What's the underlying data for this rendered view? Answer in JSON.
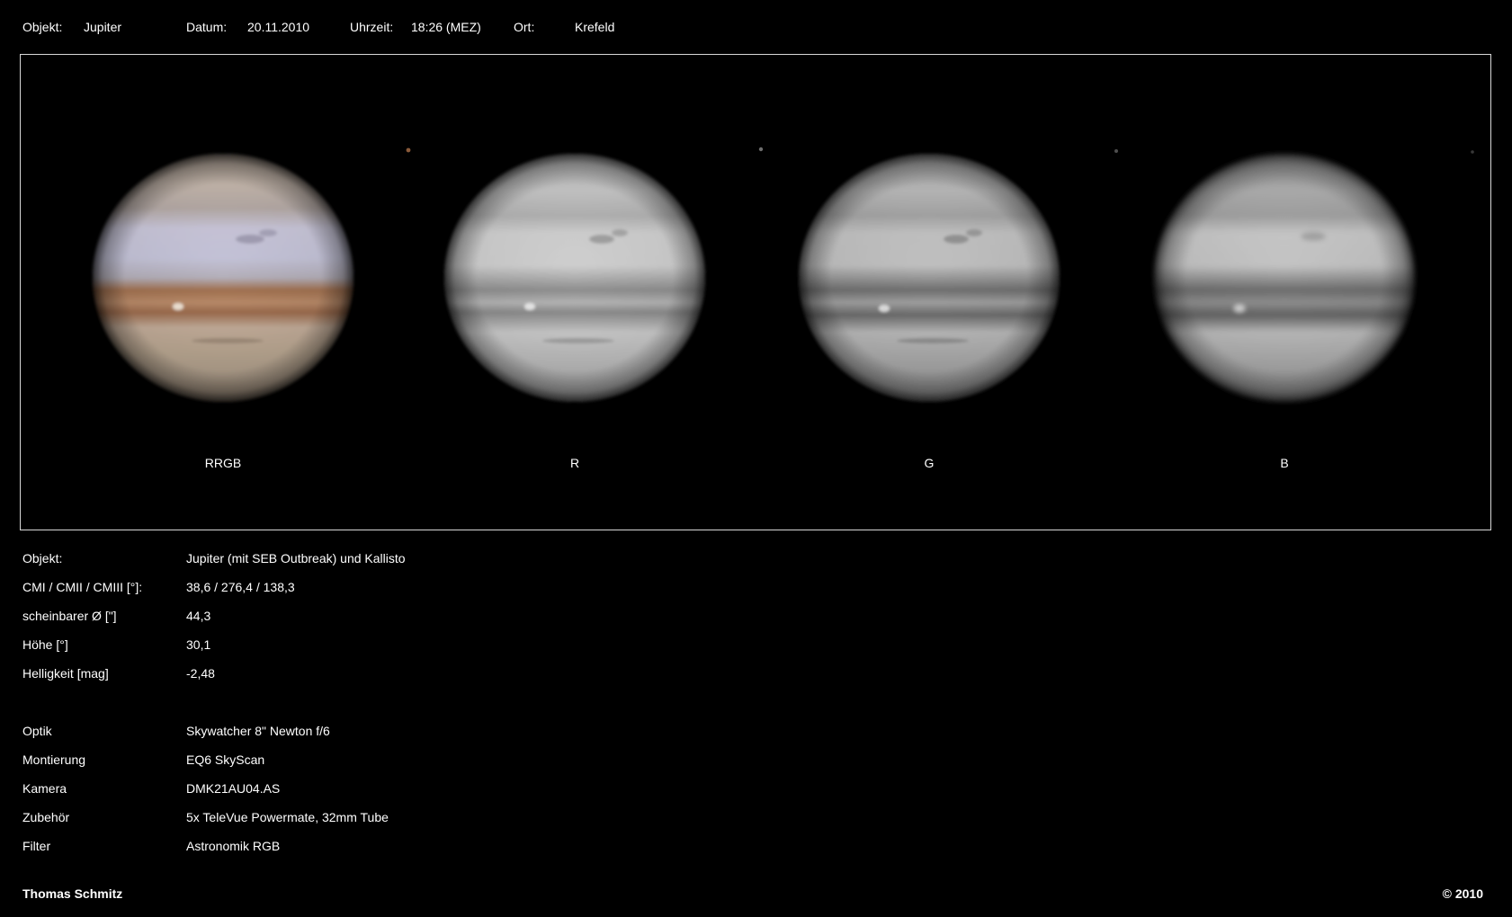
{
  "header": [
    {
      "label": "Objekt:",
      "value": "Jupiter"
    },
    {
      "label": "Datum:",
      "value": "20.11.2010"
    },
    {
      "label": "Uhrzeit:",
      "value": "18:26 (MEZ)"
    },
    {
      "label": "Ort:",
      "value": "Krefeld"
    }
  ],
  "panels": [
    {
      "label": "RRGB",
      "type": "color"
    },
    {
      "label": "R",
      "type": "gray"
    },
    {
      "label": "G",
      "type": "gray"
    },
    {
      "label": "B",
      "type": "gray"
    }
  ],
  "details": [
    {
      "label": "Objekt:",
      "value": "Jupiter (mit SEB Outbreak) und Kallisto"
    },
    {
      "label": "CMI / CMII / CMIII [°]:",
      "value": "38,6 / 276,4 / 138,3"
    },
    {
      "label": "scheinbarer Ø [\"]",
      "value": "44,3"
    },
    {
      "label": "Höhe [°]",
      "value": "30,1"
    },
    {
      "label": "Helligkeit [mag]",
      "value": "-2,48"
    }
  ],
  "equipment": [
    {
      "label": "Optik",
      "value": "Skywatcher 8\" Newton f/6"
    },
    {
      "label": "Montierung",
      "value": "EQ6 SkyScan"
    },
    {
      "label": "Kamera",
      "value": "DMK21AU04.AS"
    },
    {
      "label": "Zubehör",
      "value": "5x TeleVue Powermate, 32mm Tube"
    },
    {
      "label": "Filter",
      "value": "Astronomik RGB"
    }
  ],
  "footer": {
    "author": "Thomas Schmitz",
    "copyright": "© 2010"
  },
  "colors": {
    "background": "#000000",
    "text": "#ffffff",
    "frame": "#d8d8d8",
    "belt_color": "#a0704f",
    "zone_color": "#c9c6d9"
  }
}
